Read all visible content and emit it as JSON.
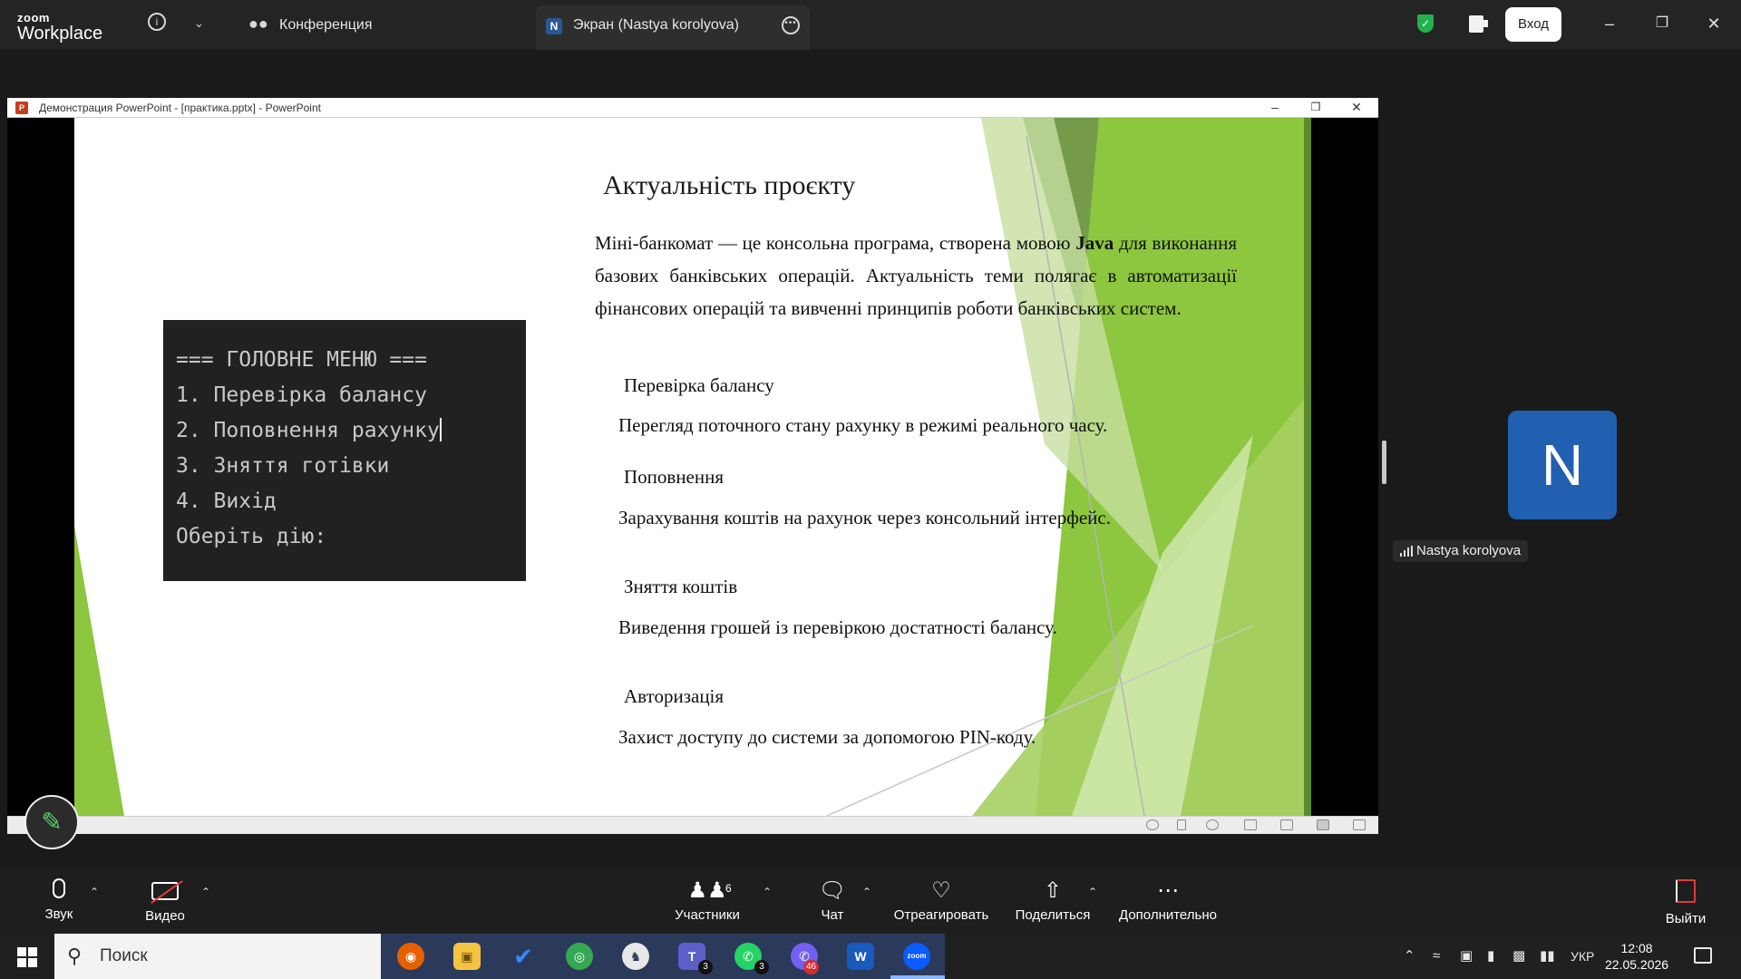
{
  "zoom": {
    "logo_top": "zoom",
    "logo_bottom": "Workplace",
    "tab_conference": "Конференция",
    "tab_screen": "Экран (Nastya korolyova)",
    "screen_badge": "N",
    "login_button": "Вход",
    "accent_color": "#0b5cff"
  },
  "ppt": {
    "window_title": "Демонстрация PowerPoint - [практика.pptx] - PowerPoint",
    "slide": {
      "title": "Актуальність проєкту",
      "intro_before_bold": "Міні-банкомат — це консольна програма, створена мовою ",
      "intro_bold": "Java",
      "intro_after_bold": " для виконання базових банківських операцій. Актуальність теми полягає в автоматизації фінансових операцій та вивченні принципів роботи банківських систем.",
      "features": [
        {
          "heading": "Перевірка балансу",
          "description": "Перегляд поточного стану рахунку в режимі реального часу."
        },
        {
          "heading": "Поповнення",
          "description": "Зарахування коштів на рахунок через консольний інтерфейс."
        },
        {
          "heading": "Зняття коштів",
          "description": "Виведення грошей із перевіркою достатності балансу."
        },
        {
          "heading": "Авторизація",
          "description": "Захист доступу до системи за допомогою PIN-коду."
        }
      ],
      "console_lines": [
        "=== ГОЛОВНЕ МЕНЮ ===",
        "1. Перевірка балансу",
        "2. Поповнення рахунку",
        "3. Зняття готівки",
        "4. Вихід",
        "Оберіть дію:"
      ],
      "accent_green": "#8dc63f"
    }
  },
  "participant": {
    "initial": "N",
    "name": "Nastya korolyova",
    "avatar_color": "#2160b0"
  },
  "controls": {
    "audio": "Звук",
    "video": "Видео",
    "participants": "Участники",
    "participants_count": "6",
    "chat": "Чат",
    "react": "Отреагировать",
    "share": "Поделиться",
    "more": "Дополнительно",
    "leave": "Выйти"
  },
  "taskbar": {
    "search_placeholder": "Поиск",
    "teams_badge": "3",
    "whatsapp_badge": "3",
    "viber_badge": "46",
    "language": "УКР",
    "time": "12:08",
    "date": "22.05.2026"
  }
}
